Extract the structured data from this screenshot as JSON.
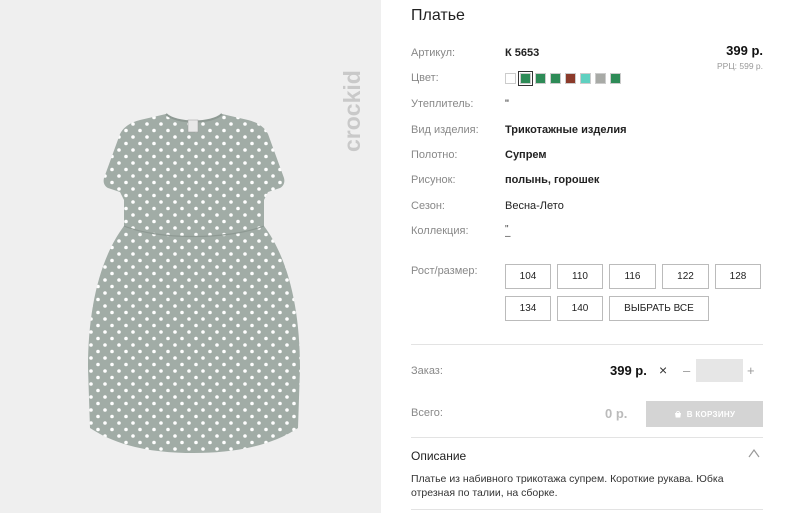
{
  "product": {
    "title": "Платье",
    "price": "399 р.",
    "rrp": "РРЦ: 599 р."
  },
  "brand": {
    "logo_text": "crockid"
  },
  "attributes": [
    {
      "label": "Артикул:",
      "value": "К 5653"
    },
    {
      "label": "Цвет:"
    },
    {
      "label": "Утеплитель:",
      "value": "\""
    },
    {
      "label": "Вид изделия:",
      "value": "Трикотажные изделия"
    },
    {
      "label": "Полотно:",
      "value": "Супрем"
    },
    {
      "label": "Рисунок:",
      "value": "полынь, горошек"
    },
    {
      "label": "Сезон:",
      "value": "Весна-Лето"
    },
    {
      "label": "Коллекция:",
      "value": "\"\n–"
    }
  ],
  "colors": [
    "#ffffff",
    "#2e8b57",
    "#2e8b57",
    "#2e8b57",
    "#8b3a2a",
    "#5fd0c0",
    "#a8aaa6",
    "#2e8b57"
  ],
  "sizes": {
    "label": "Рост/размер:",
    "options": [
      "104",
      "110",
      "116",
      "122",
      "128",
      "134",
      "140"
    ],
    "select_all": "ВЫБРАТЬ ВСЕ"
  },
  "order": {
    "label": "Заказ:",
    "price": "399 р.",
    "times": "×",
    "minus": "–",
    "plus": "+",
    "quantity": ""
  },
  "total": {
    "label": "Всего:",
    "value": "0 р.",
    "cart_button": "В КОРЗИНУ"
  },
  "description": {
    "title": "Описание",
    "text": "Платье из набивного трикотажа супрем. Короткие рукава. Юбка отрезная по талии, на сборке."
  }
}
